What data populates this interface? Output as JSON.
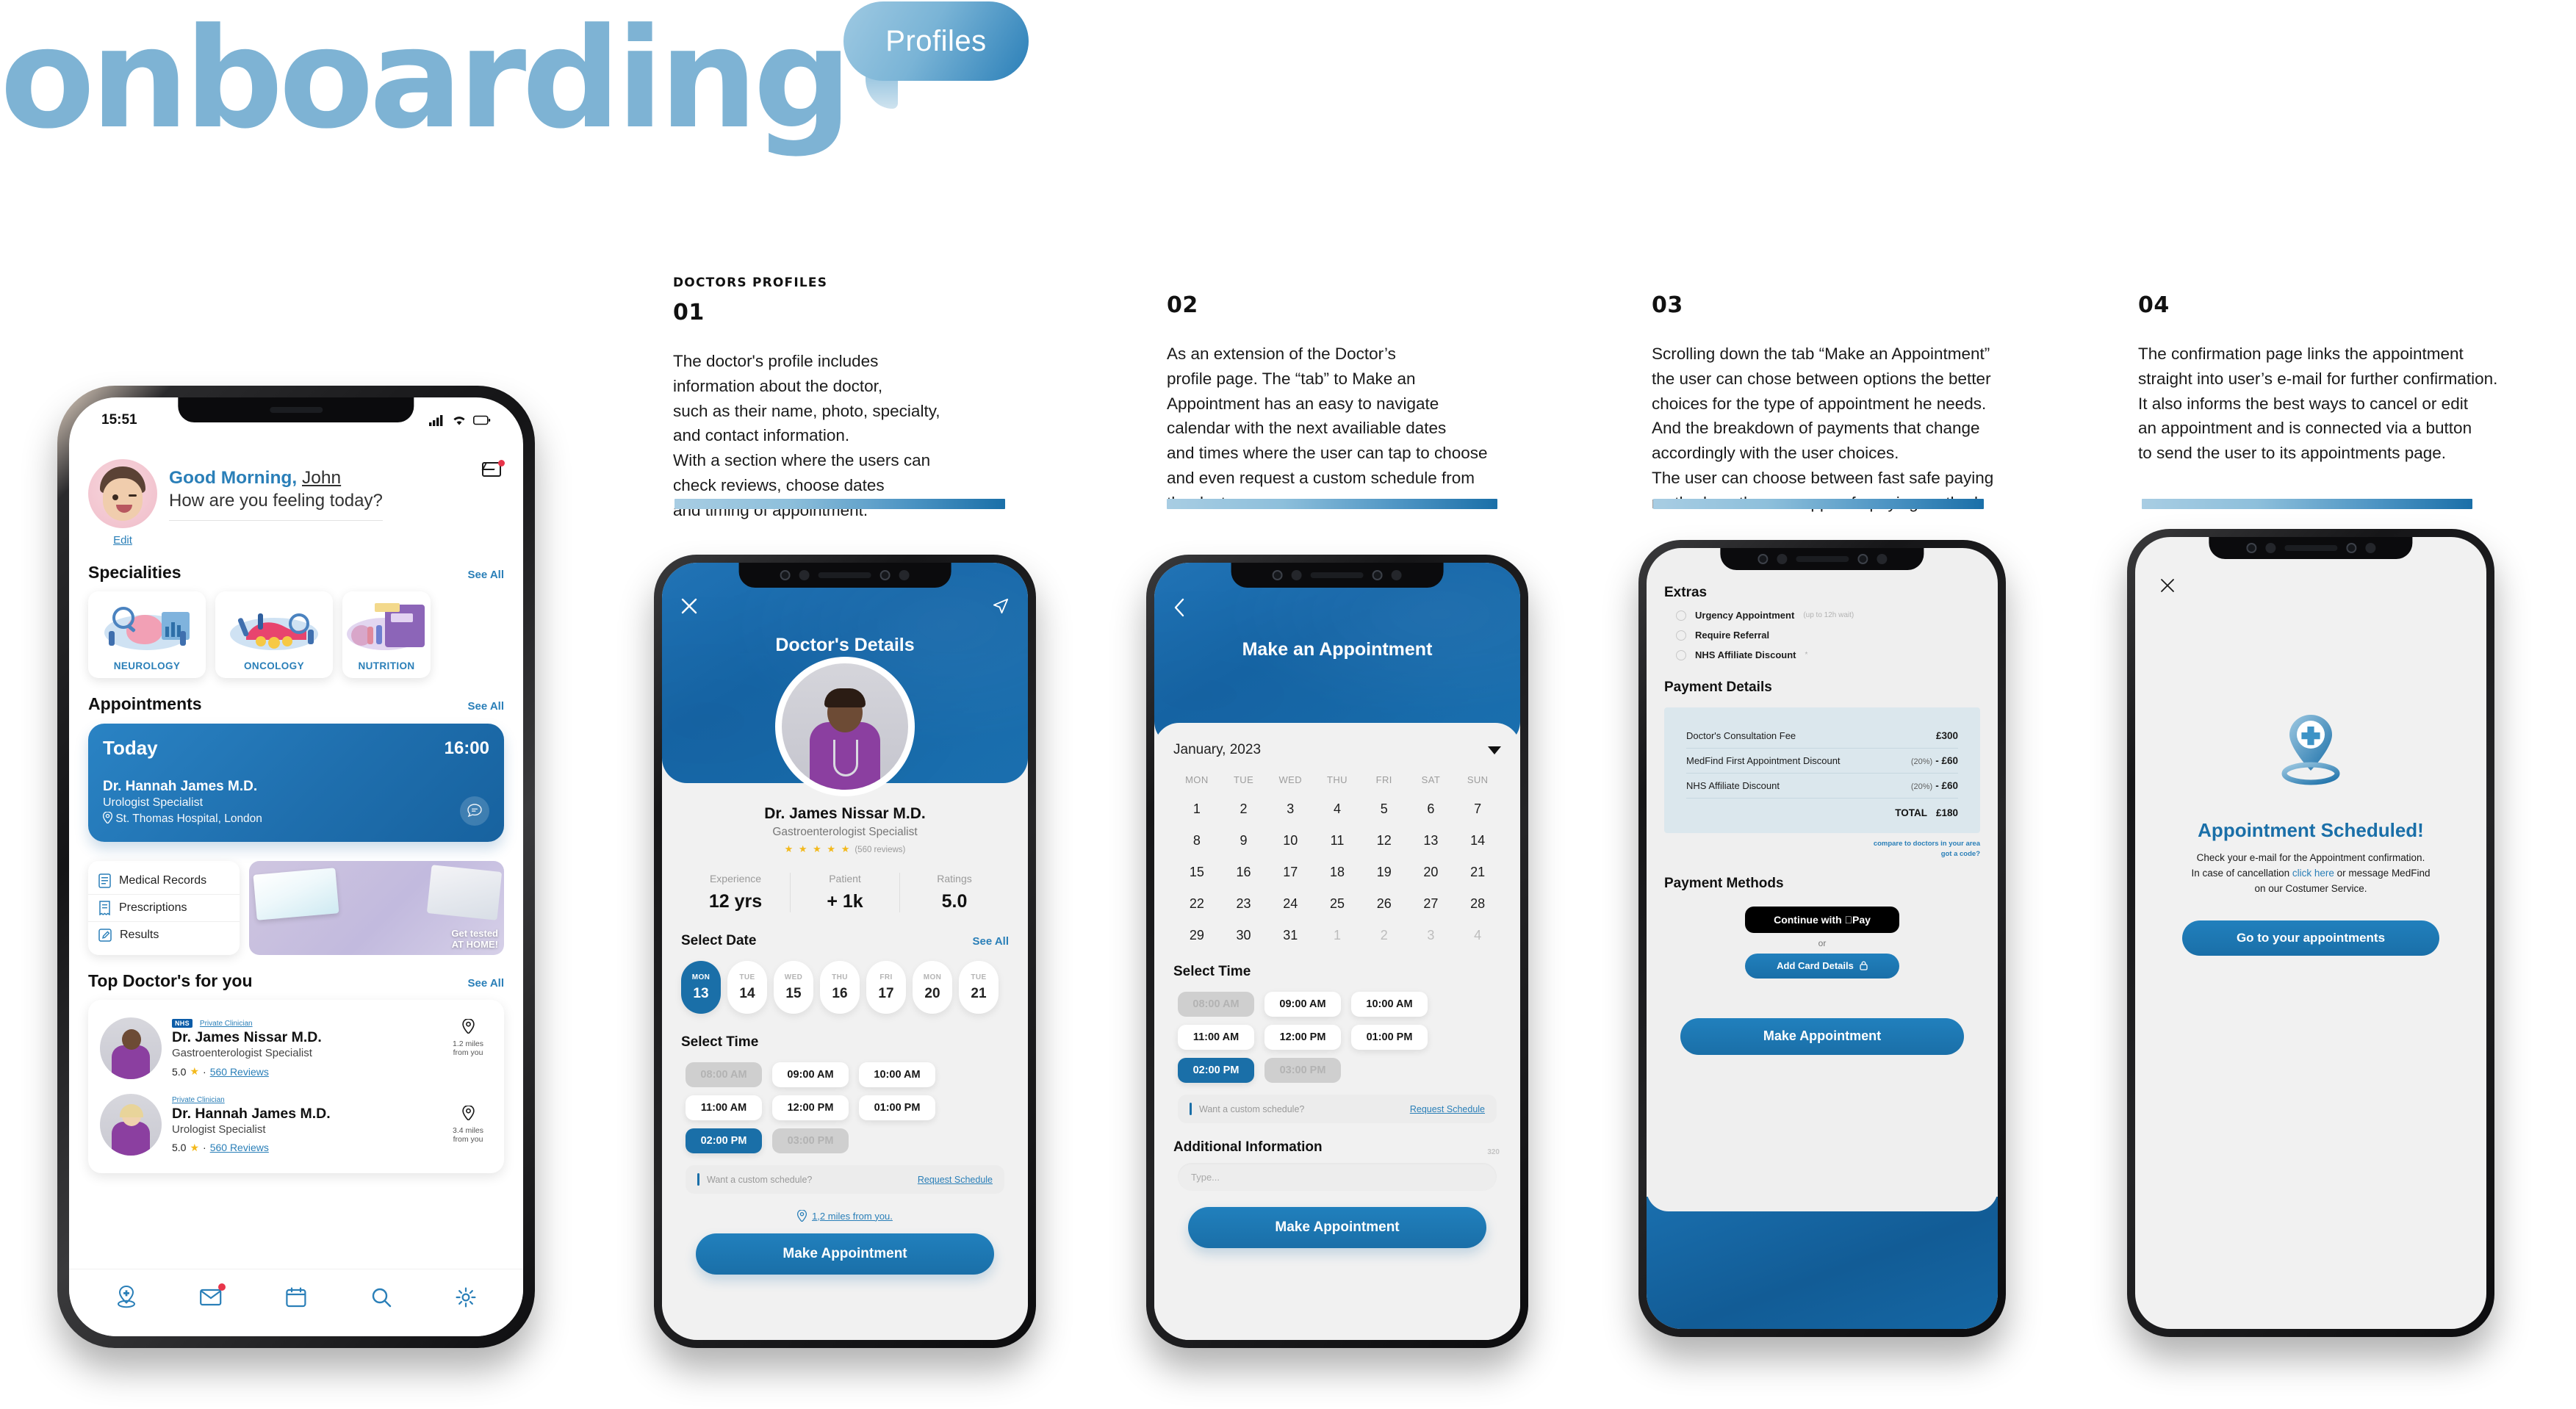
{
  "header": {
    "brand": "onboarding",
    "bubble_label": "Profiles"
  },
  "notes": [
    {
      "kicker": "DOCTORS PROFILES",
      "num": "01",
      "body": "The doctor's profile includes\ninformation about the doctor,\nsuch as their name, photo, specialty,\nand contact information.\nWith a section where the users can\ncheck reviews, choose dates\nand timing of appointment."
    },
    {
      "kicker": "",
      "num": "02",
      "body": "As an extension of the Doctor’s\nprofile page. The “tab” to Make an\nAppointment has an easy to navigate\ncalendar with the next availiable dates\nand times where the user can tap to choose\nand even request a custom schedule from\nthe doctor."
    },
    {
      "kicker": "",
      "num": "03",
      "body": "Scrolling down the tab “Make an Appointment”\nthe user can chose between options the better\nchoices for the type of appointment he needs.\nAnd the breakdown of payments that change\naccordingly with the user choices.\nThe user can choose between fast safe paying\nmethods or the own app safe paying method."
    },
    {
      "kicker": "",
      "num": "04",
      "body": "The confirmation page links the appointment\nstraight into user’s e-mail for further confirmation.\nIt also informs the best ways to cancel or edit\nan appointment and is connected via a button\nto send the user to its appointments page."
    }
  ],
  "home": {
    "status_time": "15:51",
    "greeting_prefix": "Good Morning",
    "greeting_comma": ",",
    "user_name": "John",
    "greeting_question": "How are you feeling today?",
    "edit_label": "Edit",
    "specialities_title": "Specialities",
    "specialities_see_all": "See All",
    "specialities": [
      {
        "label": "NEUROLOGY"
      },
      {
        "label": "ONCOLOGY"
      },
      {
        "label": "NUTRITION"
      }
    ],
    "appointments_title": "Appointments",
    "appointments_see_all": "See All",
    "appointment": {
      "day_label": "Today",
      "time": "16:00",
      "doctor": "Dr. Hannah James M.D.",
      "specialty": "Urologist Specialist",
      "location": "St. Thomas Hospital, London"
    },
    "quick_links": [
      {
        "label": "Medical Records"
      },
      {
        "label": "Prescriptions"
      },
      {
        "label": "Results"
      }
    ],
    "promo": {
      "line1": "Get tested",
      "line2": "AT HOME!"
    },
    "top_doctors_title": "Top Doctor's for you",
    "top_doctors_see_all": "See All",
    "top_doctors": [
      {
        "nhs_tag": "NHS",
        "private_tag": "Private Clinician",
        "name": "Dr. James Nissar M.D.",
        "specialty": "Gastroenterologist Specialist",
        "rating": "5.0",
        "reviews": "560 Reviews",
        "distance": "1.2 miles",
        "distance_sub": "from you"
      },
      {
        "nhs_tag": "",
        "private_tag": "Private Clinician",
        "name": "Dr. Hannah James M.D.",
        "specialty": "Urologist Specialist",
        "rating": "5.0",
        "reviews": "560 Reviews",
        "distance": "3.4 miles",
        "distance_sub": "from you"
      }
    ],
    "tabs": [
      {
        "icon": "location-pin-medical-icon"
      },
      {
        "icon": "envelope-icon"
      },
      {
        "icon": "calendar-icon"
      },
      {
        "icon": "search-icon"
      },
      {
        "icon": "gear-icon"
      }
    ]
  },
  "profile": {
    "title": "Doctor's Details",
    "doctor_name": "Dr. James Nissar M.D.",
    "doctor_specialty": "Gastroenterologist Specialist",
    "stars": "★ ★ ★ ★ ★",
    "reviews": "(560 reviews)",
    "stats": [
      {
        "key": "Experience",
        "value": "12 yrs"
      },
      {
        "key": "Patient",
        "value": "+ 1k"
      },
      {
        "key": "Ratings",
        "value": "5.0"
      }
    ],
    "select_date_title": "Select Date",
    "select_date_see_all": "See All",
    "dates": [
      {
        "dow": "MON",
        "day": "13",
        "selected": true
      },
      {
        "dow": "TUE",
        "day": "14",
        "selected": false
      },
      {
        "dow": "WED",
        "day": "15",
        "selected": false
      },
      {
        "dow": "THU",
        "day": "16",
        "selected": false
      },
      {
        "dow": "FRI",
        "day": "17",
        "selected": false
      },
      {
        "dow": "MON",
        "day": "20",
        "selected": false
      },
      {
        "dow": "TUE",
        "day": "21",
        "selected": false
      }
    ],
    "select_time_title": "Select Time",
    "times": [
      {
        "label": "08:00 AM",
        "state": "disabled"
      },
      {
        "label": "09:00 AM",
        "state": "normal"
      },
      {
        "label": "10:00 AM",
        "state": "normal"
      },
      {
        "label": "11:00 AM",
        "state": "normal"
      },
      {
        "label": "12:00 PM",
        "state": "normal"
      },
      {
        "label": "01:00 PM",
        "state": "normal"
      },
      {
        "label": "02:00 PM",
        "state": "selected"
      },
      {
        "label": "03:00 PM",
        "state": "disabled"
      }
    ],
    "custom_placeholder": "Want a custom schedule?",
    "request_schedule": "Request Schedule",
    "distance": "1,2 miles from you.",
    "cta": "Make Appointment"
  },
  "calendar": {
    "title": "Make an Appointment",
    "month": "January, 2023",
    "dow": [
      "MON",
      "TUE",
      "WED",
      "THU",
      "FRI",
      "SAT",
      "SUN"
    ],
    "days": [
      {
        "n": "1",
        "mute": false
      },
      {
        "n": "2",
        "mute": false
      },
      {
        "n": "3",
        "mute": false
      },
      {
        "n": "4",
        "mute": false
      },
      {
        "n": "5",
        "mute": false
      },
      {
        "n": "6",
        "mute": false
      },
      {
        "n": "7",
        "mute": false
      },
      {
        "n": "8",
        "mute": false
      },
      {
        "n": "9",
        "mute": false
      },
      {
        "n": "10",
        "mute": false
      },
      {
        "n": "11",
        "mute": false
      },
      {
        "n": "12",
        "mute": false
      },
      {
        "n": "13",
        "mute": false
      },
      {
        "n": "14",
        "mute": false
      },
      {
        "n": "15",
        "mute": false
      },
      {
        "n": "16",
        "mute": false
      },
      {
        "n": "17",
        "mute": false
      },
      {
        "n": "18",
        "mute": false
      },
      {
        "n": "19",
        "mute": false
      },
      {
        "n": "20",
        "mute": false
      },
      {
        "n": "21",
        "mute": false
      },
      {
        "n": "22",
        "mute": false
      },
      {
        "n": "23",
        "mute": false
      },
      {
        "n": "24",
        "mute": false
      },
      {
        "n": "25",
        "mute": false
      },
      {
        "n": "26",
        "mute": false
      },
      {
        "n": "27",
        "mute": false
      },
      {
        "n": "28",
        "mute": false
      },
      {
        "n": "29",
        "mute": false
      },
      {
        "n": "30",
        "mute": false
      },
      {
        "n": "31",
        "mute": false
      },
      {
        "n": "1",
        "mute": true
      },
      {
        "n": "2",
        "mute": true
      },
      {
        "n": "3",
        "mute": true
      },
      {
        "n": "4",
        "mute": true
      }
    ],
    "select_time_title": "Select Time",
    "times": [
      {
        "label": "08:00 AM",
        "state": "disabled"
      },
      {
        "label": "09:00 AM",
        "state": "normal"
      },
      {
        "label": "10:00 AM",
        "state": "normal"
      },
      {
        "label": "11:00 AM",
        "state": "normal"
      },
      {
        "label": "12:00 PM",
        "state": "normal"
      },
      {
        "label": "01:00 PM",
        "state": "normal"
      },
      {
        "label": "02:00 PM",
        "state": "selected"
      },
      {
        "label": "03:00 PM",
        "state": "disabled"
      }
    ],
    "custom_placeholder": "Want a custom schedule?",
    "request_schedule": "Request Schedule",
    "additional_title": "Additional Information",
    "additional_count": "320",
    "additional_placeholder": "Type...",
    "cta": "Make Appointment"
  },
  "payment": {
    "extras_title": "Extras",
    "extras": [
      {
        "label": "Urgency Appointment",
        "sub": "(up to 12h wait)"
      },
      {
        "label": "Require Referral",
        "sub": ""
      },
      {
        "label": "NHS Affiliate Discount",
        "sub": "*"
      }
    ],
    "details_title": "Payment Details",
    "bill": [
      {
        "label": "Doctor's Consultation Fee",
        "pct": "",
        "amount": "£300"
      },
      {
        "label": "MedFind First Appointment Discount",
        "pct": "(20%)",
        "amount": "- £60"
      },
      {
        "label": "NHS Affiliate Discount",
        "pct": "(20%)",
        "amount": "- £60"
      }
    ],
    "total_label": "TOTAL",
    "total_amount": "£180",
    "link_compare": "compare to doctors in your area",
    "link_code": "got a code?",
    "methods_title": "Payment Methods",
    "apple_pay": "Continue with Pay",
    "or_label": "or",
    "add_card": "Add Card Details",
    "cta": "Make Appointment"
  },
  "done": {
    "title": "Appointment Scheduled!",
    "line1": "Check your e-mail for the Appointment confirmation.",
    "line2_a": "In case of cancellation ",
    "line2_link": "click here",
    "line2_b": " or message MedFind",
    "line3": "on our Costumer Service.",
    "cta": "Go to your appointments"
  },
  "colors": {
    "brand_blue": "#1a6fa8",
    "brand_light": "#7eb3d4",
    "accent_link": "#2a7fb8",
    "header_blue": "#1667a9",
    "star_yellow": "#f3b91c",
    "badge_red": "#e8354a"
  }
}
